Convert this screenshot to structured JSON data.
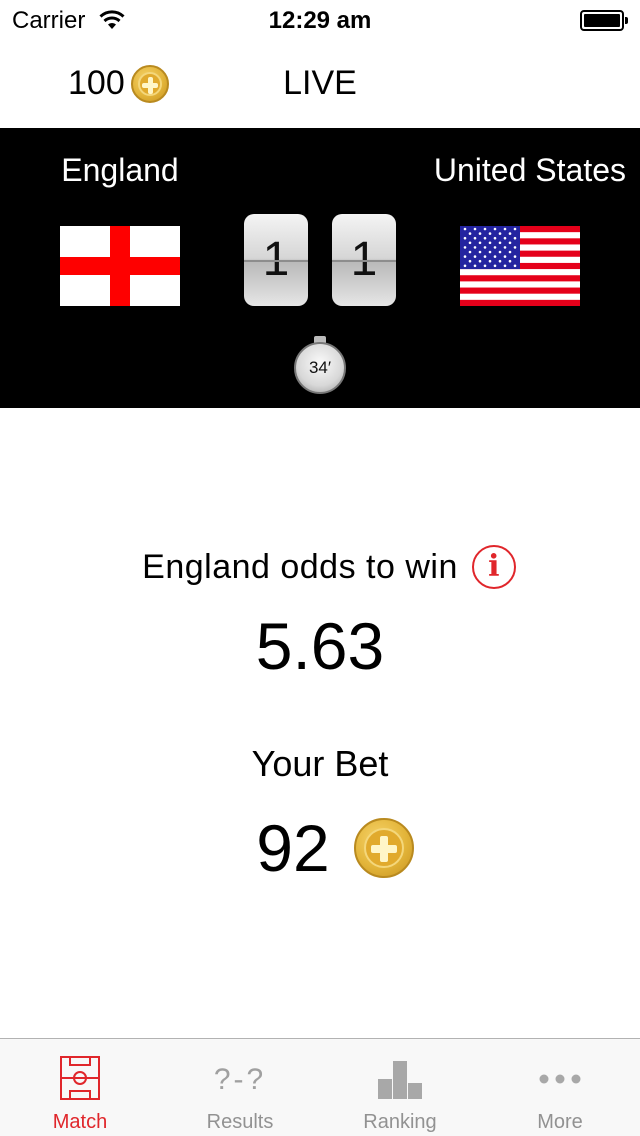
{
  "status_bar": {
    "carrier": "Carrier",
    "time": "12:29 am"
  },
  "header": {
    "coin_balance": "100",
    "title": "LIVE"
  },
  "match": {
    "home_team": "England",
    "away_team": "United States",
    "home_score": "1",
    "away_score": "1",
    "minute": "34′"
  },
  "odds": {
    "label": "England odds to win",
    "value": "5.63",
    "info_symbol": "i"
  },
  "bet": {
    "label": "Your Bet",
    "amount": "92"
  },
  "tabs": [
    {
      "label": "Match",
      "icon": "pitch-icon",
      "active": true
    },
    {
      "label": "Results",
      "icon": "question-score-icon",
      "glyph": "?-?",
      "active": false
    },
    {
      "label": "Ranking",
      "icon": "bar-chart-icon",
      "active": false
    },
    {
      "label": "More",
      "icon": "ellipsis-icon",
      "active": false
    }
  ],
  "colors": {
    "accent": "#e0262b",
    "scoreboard_bg": "#000000",
    "coin_gold": "#e3b53a",
    "tab_inactive": "#929292"
  }
}
